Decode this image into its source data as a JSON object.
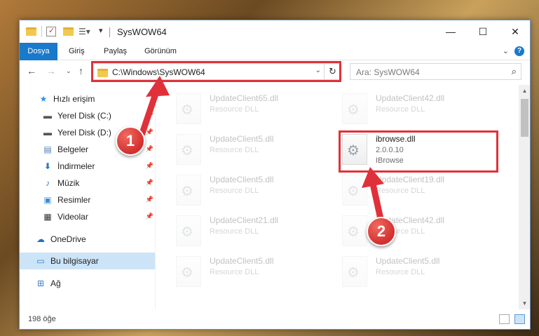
{
  "window": {
    "title": "SysWOW64",
    "controls": {
      "minimize": "—",
      "maximize": "☐",
      "close": "✕"
    }
  },
  "ribbon": {
    "tabs": [
      {
        "label": "Dosya",
        "active": true
      },
      {
        "label": "Giriş"
      },
      {
        "label": "Paylaş"
      },
      {
        "label": "Görünüm"
      }
    ],
    "help": "?"
  },
  "address": {
    "path": "C:\\Windows\\SysWOW64",
    "search_placeholder": "Ara: SysWOW64"
  },
  "sidebar": {
    "items": [
      {
        "label": "Hızlı erişim",
        "icon": "star-icon"
      },
      {
        "label": "Yerel Disk (C:)",
        "icon": "drive-icon",
        "pinned": true
      },
      {
        "label": "Yerel Disk (D:)",
        "icon": "drive-icon",
        "pinned": true
      },
      {
        "label": "Belgeler",
        "icon": "documents-icon",
        "pinned": true
      },
      {
        "label": "İndirmeler",
        "icon": "download-icon",
        "pinned": true
      },
      {
        "label": "Müzik",
        "icon": "music-icon",
        "pinned": true
      },
      {
        "label": "Resimler",
        "icon": "pictures-icon",
        "pinned": true
      },
      {
        "label": "Videolar",
        "icon": "videos-icon",
        "pinned": true
      },
      {
        "label": "OneDrive",
        "icon": "cloud-icon"
      },
      {
        "label": "Bu bilgisayar",
        "icon": "computer-icon",
        "selected": true
      },
      {
        "label": "Ağ",
        "icon": "network-icon"
      }
    ]
  },
  "files": [
    {
      "name": "UpdateClient65.dll",
      "line1": "Resource DLL",
      "line2": "",
      "faded": true
    },
    {
      "name": "UpdateClient42.dll",
      "line1": "Resource DLL",
      "line2": "",
      "faded": true
    },
    {
      "name": "UpdateClient5.dll",
      "line1": "Resource DLL",
      "line2": "",
      "faded": true
    },
    {
      "name": "ibrowse.dll",
      "line1": "2.0.0.10",
      "line2": "IBrowse",
      "faded": false
    },
    {
      "name": "UpdateClient5.dll",
      "line1": "Resource DLL",
      "line2": "",
      "faded": true
    },
    {
      "name": "UpdateClient19.dll",
      "line1": "Resource DLL",
      "line2": "",
      "faded": true
    },
    {
      "name": "UpdateClient21.dll",
      "line1": "Resource DLL",
      "line2": "",
      "faded": true
    },
    {
      "name": "UpdateClient42.dll",
      "line1": "Resource DLL",
      "line2": "",
      "faded": true
    },
    {
      "name": "UpdateClient5.dll",
      "line1": "Resource DLL",
      "line2": "",
      "faded": true
    },
    {
      "name": "UpdateClient5.dll",
      "line1": "Resource DLL",
      "line2": "",
      "faded": true
    }
  ],
  "status": {
    "item_count": "198 öğe"
  },
  "annotations": {
    "badge1": "1",
    "badge2": "2",
    "highlight_color": "#e0313a"
  }
}
